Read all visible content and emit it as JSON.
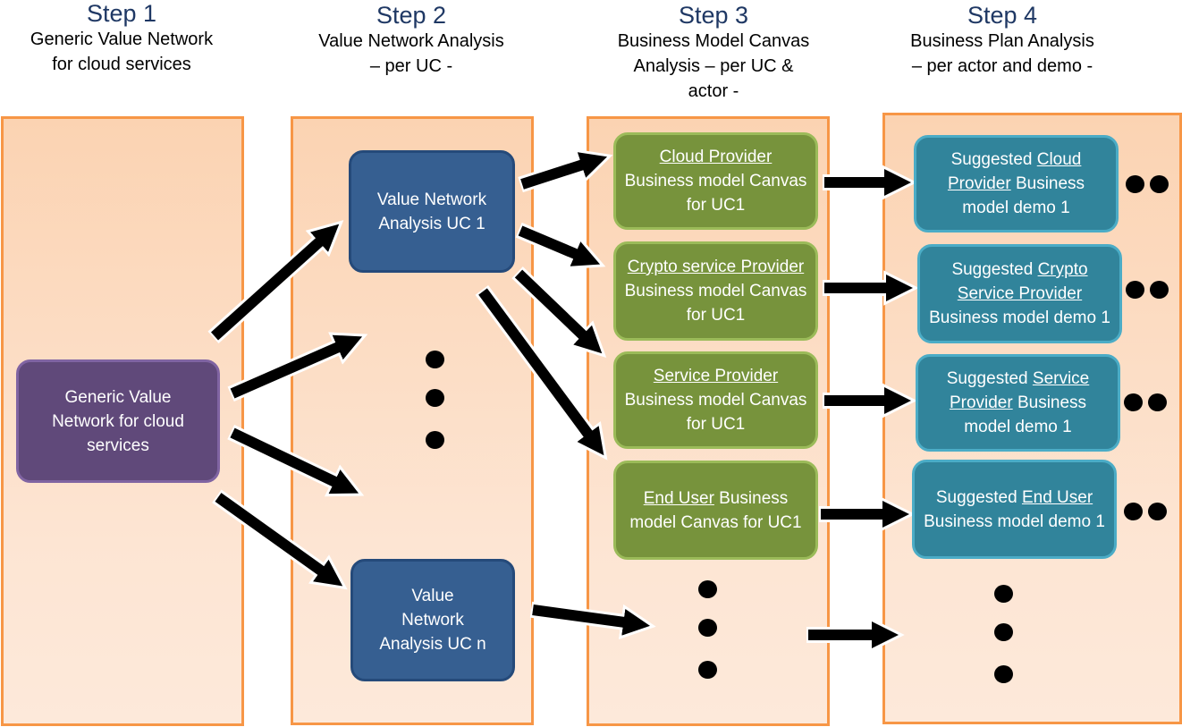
{
  "steps": [
    {
      "title": "Step 1",
      "subtitle": "Generic Value Network\nfor cloud services"
    },
    {
      "title": "Step 2",
      "subtitle": "Value Network Analysis\n– per UC -"
    },
    {
      "title": "Step 3",
      "subtitle": "Business Model Canvas\nAnalysis – per UC &\nactor -"
    },
    {
      "title": "Step 4",
      "subtitle": "Business Plan Analysis\n– per actor and demo -"
    }
  ],
  "step1": {
    "generic": {
      "text": "Generic Value Network for cloud services"
    }
  },
  "step2": {
    "uc1": {
      "text": "Value Network Analysis UC 1"
    },
    "ucn": {
      "text": "Value Network Analysis UC n"
    }
  },
  "step3": {
    "canvases": [
      {
        "actor": "Cloud Provider",
        "rest": " Business model Canvas for UC1"
      },
      {
        "actor": "Crypto service Provider",
        "rest": " Business model Canvas for UC1"
      },
      {
        "actor": "Service Provider",
        "rest": " Business model Canvas for UC1"
      },
      {
        "actor": "End User",
        "rest": " Business model Canvas for UC1"
      }
    ]
  },
  "step4": {
    "plans": [
      {
        "prefix": "Suggested ",
        "actor": "Cloud Provider",
        "rest": " Business model demo 1"
      },
      {
        "prefix": "Suggested ",
        "actor": "Crypto Service Provider",
        "rest": " Business model demo 1"
      },
      {
        "prefix": "Suggested ",
        "actor": "Service Provider",
        "rest": " Business model demo 1"
      },
      {
        "prefix": "Suggested ",
        "actor": "End User",
        "rest": " Business model demo 1"
      }
    ]
  },
  "colors": {
    "step_title": "#1F3864",
    "panel_border": "#F79646",
    "panel_fill": "#FBD3B2",
    "generic_node": "#60497A",
    "value_network_node": "#365F91",
    "canvas_node": "#77933C",
    "plan_node": "#31849B",
    "arrow": "#000000"
  }
}
